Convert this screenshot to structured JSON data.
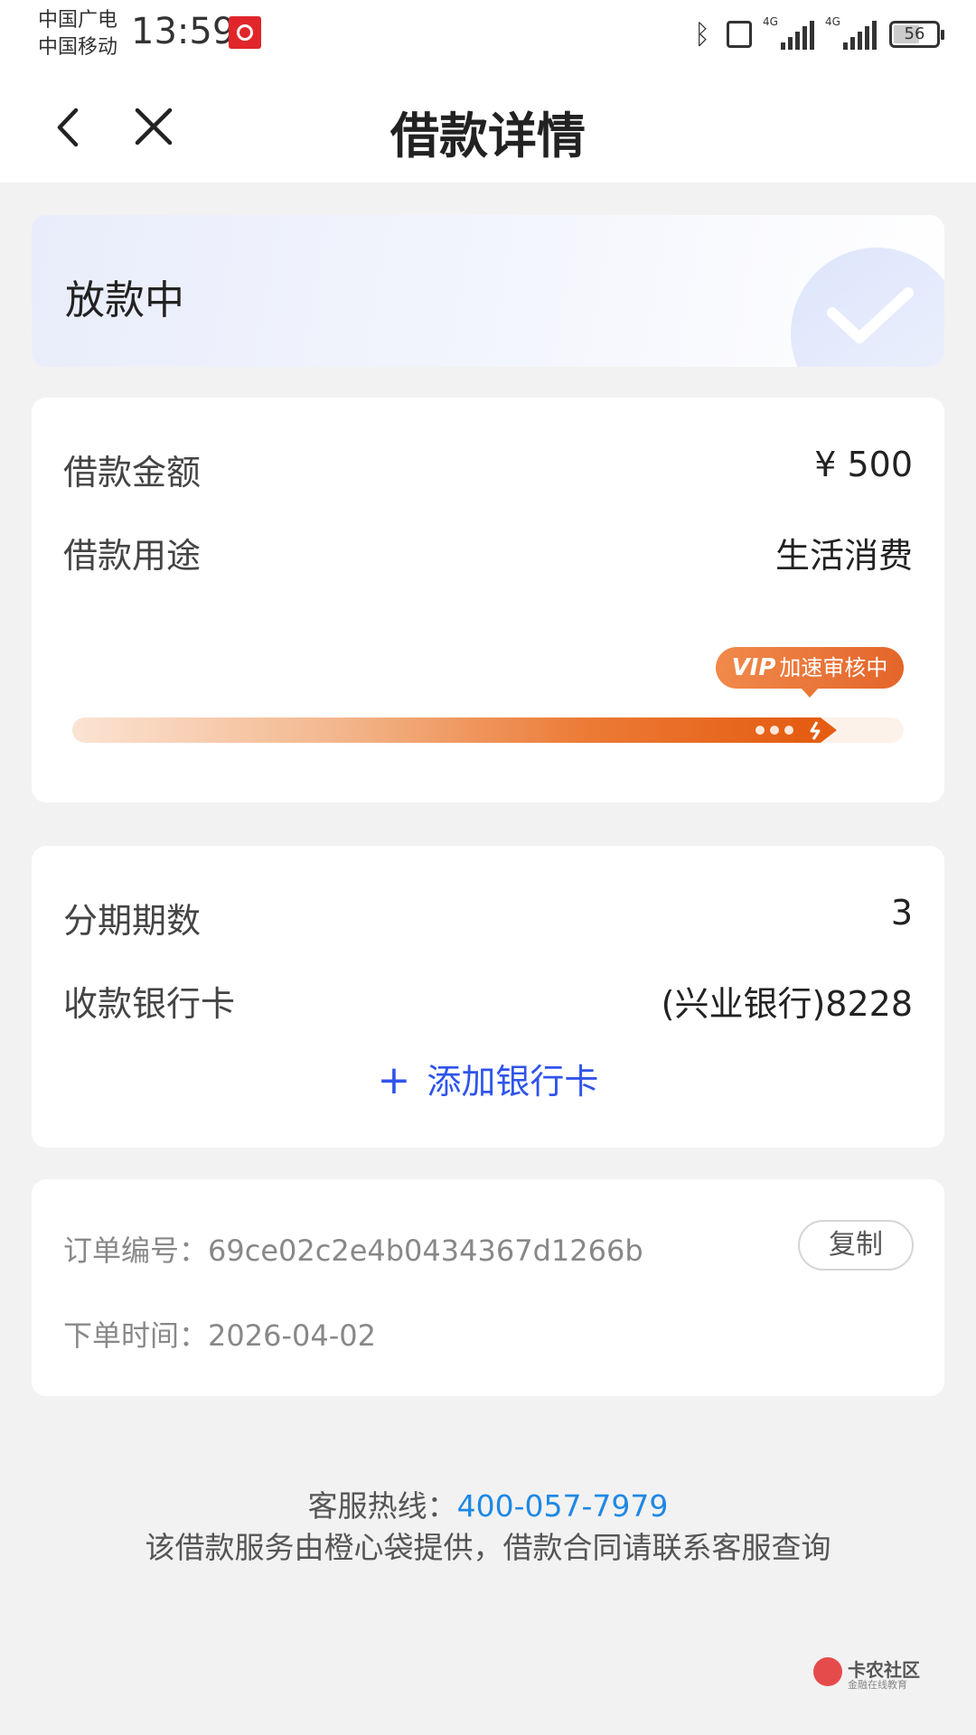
{
  "status_bar": {
    "carrier_1": "中国广电",
    "carrier_2": "中国移动",
    "time": "13:59",
    "network_1": "4G",
    "network_2": "4G",
    "battery": "56"
  },
  "header": {
    "title": "借款详情",
    "back_icon": "chevron-left-icon",
    "close_icon": "close-icon"
  },
  "status_card": {
    "status": "放款中",
    "icon": "check-icon"
  },
  "loan_card": {
    "amount_label": "借款金额",
    "amount_value": "¥ 500",
    "purpose_label": "借款用途",
    "purpose_value": "生活消费",
    "vip_badge": "VIP",
    "vip_text": "加速审核中",
    "progress": 0.92,
    "progress_color": "#e45d12"
  },
  "installment_card": {
    "periods_label": "分期期数",
    "periods_value": "3",
    "bank_label": "收款银行卡",
    "bank_value": "(兴业银行)8228",
    "add_card_label": "添加银行卡",
    "add_card_color": "#2f54eb"
  },
  "order_card": {
    "order_no_label": "订单编号：",
    "order_no_value": "69ce02c2e4b0434367d1266b",
    "copy_label": "复制",
    "order_time_label": "下单时间：",
    "order_time_value": "2026-04-02"
  },
  "footer": {
    "hotline_label": "客服热线：",
    "hotline_number": "400-057-7979",
    "disclaimer": "该借款服务由橙心袋提供，借款合同请联系客服查询"
  },
  "watermark": {
    "name": "卡农社区",
    "sub": "金融在线教育"
  }
}
